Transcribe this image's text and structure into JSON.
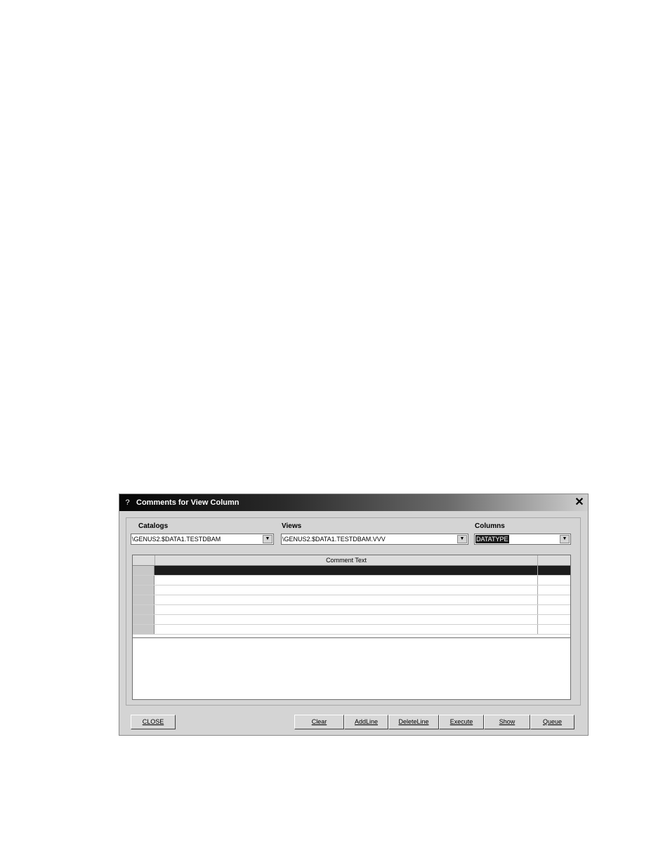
{
  "window": {
    "title": "Comments for View Column",
    "icon_glyph": "?",
    "close_glyph": "✕"
  },
  "catalogs": {
    "label": "Catalogs",
    "value": "\\GENUS2.$DATA1.TESTDBAM",
    "dropdown_glyph": "▼"
  },
  "views": {
    "label": "Views",
    "value": "\\GENUS2.$DATA1.TESTDBAM.VVV",
    "dropdown_glyph": "▼"
  },
  "columns": {
    "label": "Columns",
    "value": "DATATYPE",
    "dropdown_glyph": "▼"
  },
  "grid": {
    "header": "Comment Text",
    "row_count": 7,
    "active_row": 0
  },
  "buttons": {
    "close": "CLOSE",
    "clear": "Clear",
    "addline": "AddLine",
    "deleteline": "DeleteLine",
    "execute": "Execute",
    "show": "Show",
    "queue": "Queue"
  },
  "colors": {
    "titlebar_start": "#050505",
    "titlebar_end": "#cfcfcf",
    "dialog_bg": "#d4d4d4",
    "selection": "#1c1c1c"
  },
  "icons": {
    "app": "app-logo-icon",
    "close": "close-icon",
    "dropdown": "chevron-down-icon"
  }
}
